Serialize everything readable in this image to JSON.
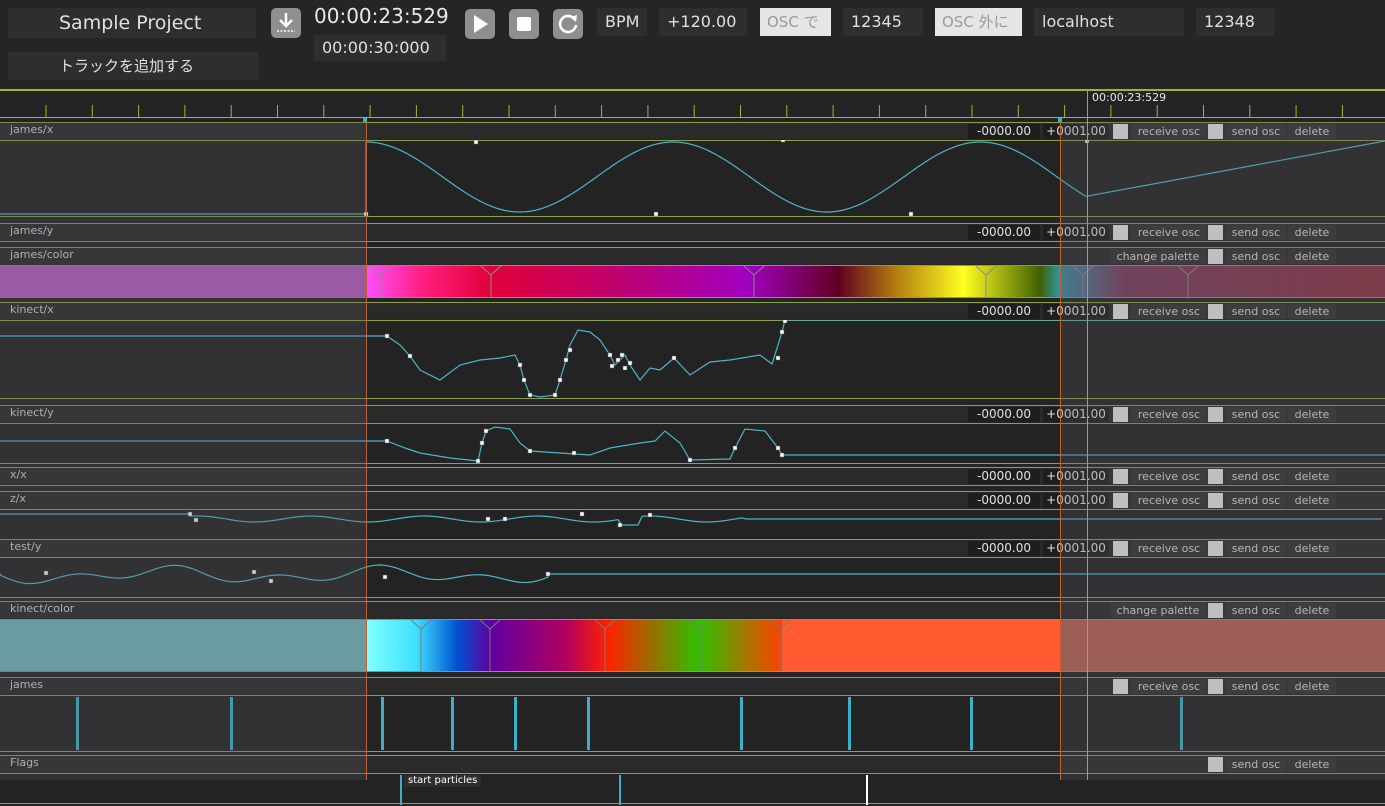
{
  "project": {
    "title": "Sample Project",
    "add_track_label": "トラックを追加する"
  },
  "transport": {
    "current_time": "00:00:23:529",
    "total_time": "00:00:30:000",
    "bpm_label": "BPM",
    "bpm_value": "+120.00"
  },
  "osc": {
    "receive_toggle_label": "OSC で",
    "receive_port": "12345",
    "send_toggle_label": "OSC 外に",
    "host": "localhost",
    "send_port": "12348"
  },
  "timeline": {
    "playhead_time": "00:00:23:529"
  },
  "labels": {
    "receive_osc": "receive osc",
    "send_osc": "send osc",
    "delete": "delete",
    "change_palette": "change palette",
    "min_value": "-0000.00",
    "max_value": "+0001.00"
  },
  "tracks": [
    {
      "name": "james/x",
      "kind": "curve"
    },
    {
      "name": "james/y",
      "kind": "curve"
    },
    {
      "name": "james/color",
      "kind": "color"
    },
    {
      "name": "kinect/x",
      "kind": "curve"
    },
    {
      "name": "kinect/y",
      "kind": "curve"
    },
    {
      "name": "x/x",
      "kind": "curve"
    },
    {
      "name": "z/x",
      "kind": "curve"
    },
    {
      "name": "test/y",
      "kind": "curve"
    },
    {
      "name": "kinect/color",
      "kind": "color"
    },
    {
      "name": "james",
      "kind": "bang"
    },
    {
      "name": "Flags",
      "kind": "flags"
    }
  ],
  "flags": {
    "first_flag": "start particles"
  },
  "colors": {
    "curve": "#4fb3c8",
    "track_line": "#8aa04a",
    "in_marker": "#c0602a",
    "bang": "#3bb0c8"
  }
}
